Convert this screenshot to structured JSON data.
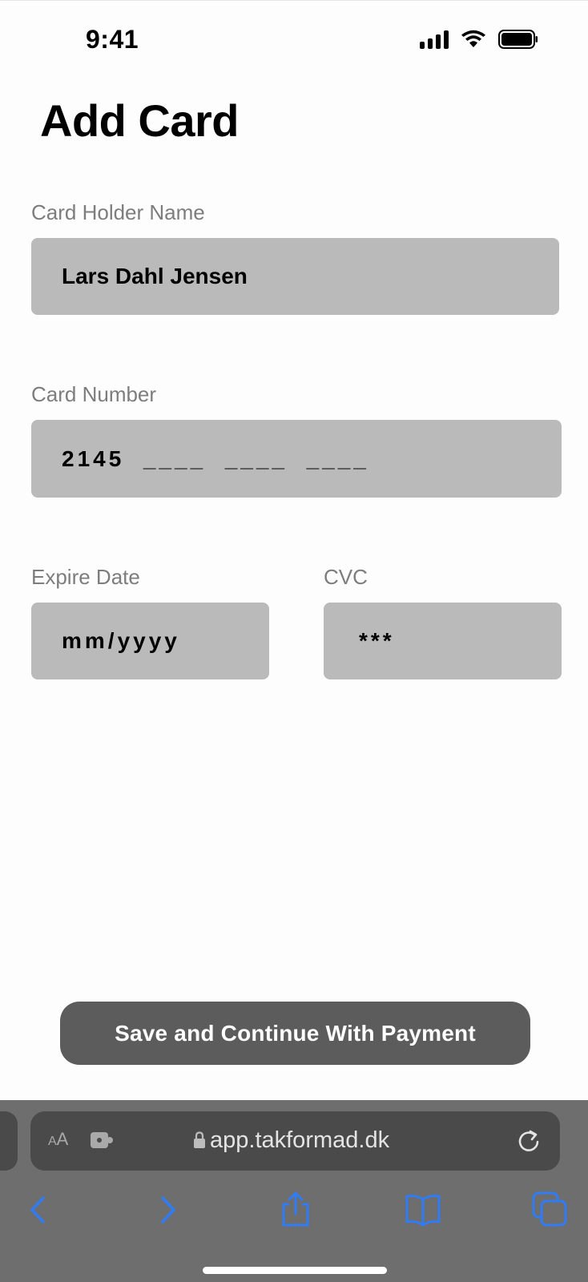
{
  "status_bar": {
    "time": "9:41"
  },
  "page": {
    "title": "Add Card"
  },
  "form": {
    "card_holder": {
      "label": "Card Holder Name",
      "value": "Lars Dahl Jensen"
    },
    "card_number": {
      "label": "Card Number",
      "value": "2145  ____  ____  ____"
    },
    "expire_date": {
      "label": "Expire Date",
      "value": "mm/yyyy"
    },
    "cvc": {
      "label": "CVC",
      "value": "***"
    }
  },
  "actions": {
    "save_label": "Save and Continue With Payment"
  },
  "browser": {
    "text_size_small": "A",
    "text_size_large": "A",
    "url": "app.takformad.dk",
    "accent_color": "#2f7cf6",
    "icons": [
      "text-size-icon",
      "extension-icon",
      "lock-icon",
      "reload-icon",
      "back-icon",
      "forward-icon",
      "share-icon",
      "bookmarks-icon",
      "tabs-icon"
    ]
  },
  "colors": {
    "field_background": "#bababa",
    "button_background": "#5c5c5c",
    "label_text": "#7d7d7d"
  }
}
